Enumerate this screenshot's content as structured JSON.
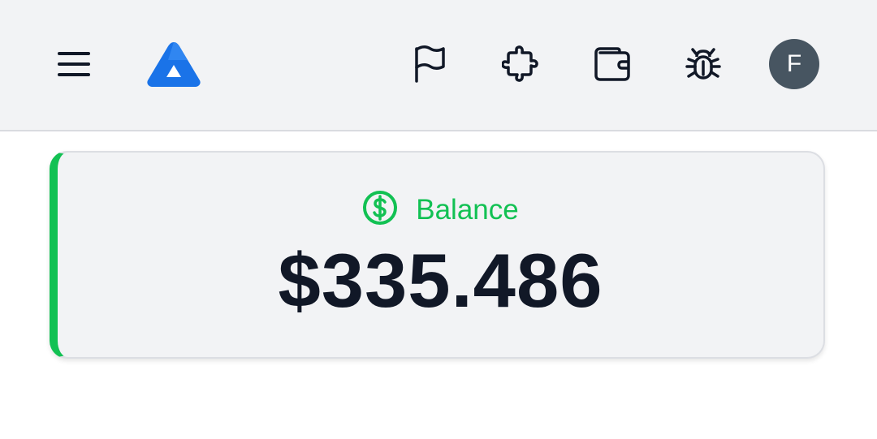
{
  "header": {
    "menu_icon": "hamburger-menu-icon",
    "logo_icon": "triangle-logo-icon",
    "icons": [
      "flag-icon",
      "puzzle-icon",
      "wallet-icon",
      "bug-icon"
    ],
    "avatar_initial": "F"
  },
  "balance_card": {
    "icon": "dollar-circle-icon",
    "label": "Balance",
    "amount": "$335.486"
  },
  "colors": {
    "accent_green": "#12c153",
    "brand_blue": "#1a73e8",
    "avatar_bg": "#475561",
    "text_dark": "#111827"
  }
}
